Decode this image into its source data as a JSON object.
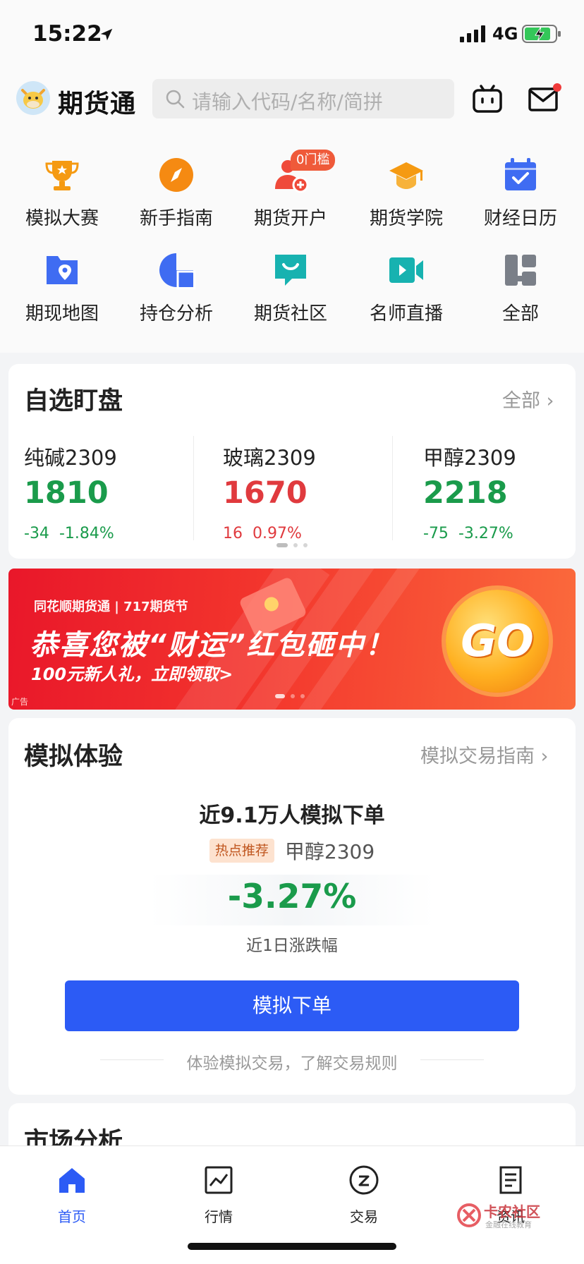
{
  "status_bar": {
    "time": "15:22",
    "network": "4G"
  },
  "header": {
    "app_name": "期货通",
    "search_placeholder": "请输入代码/名称/简拼"
  },
  "shortcuts": [
    {
      "label": "模拟大赛",
      "icon": "trophy-icon"
    },
    {
      "label": "新手指南",
      "icon": "compass-icon"
    },
    {
      "label": "期货开户",
      "icon": "user-add-icon",
      "badge": "0门槛"
    },
    {
      "label": "期货学院",
      "icon": "graduation-cap-icon"
    },
    {
      "label": "财经日历",
      "icon": "calendar-icon"
    },
    {
      "label": "期现地图",
      "icon": "map-pin-icon"
    },
    {
      "label": "持仓分析",
      "icon": "pie-chart-icon"
    },
    {
      "label": "期货社区",
      "icon": "chat-bubble-icon"
    },
    {
      "label": "名师直播",
      "icon": "video-camera-icon"
    },
    {
      "label": "全部",
      "icon": "grid-all-icon"
    }
  ],
  "watchlist": {
    "title": "自选盯盘",
    "more": "全部",
    "items": [
      {
        "name": "纯碱2309",
        "price": "1810",
        "change": "-34",
        "pct": "-1.84%",
        "color": "#1a9b4b"
      },
      {
        "name": "玻璃2309",
        "price": "1670",
        "change": "16",
        "pct": "0.97%",
        "color": "#e03a3e"
      },
      {
        "name": "甲醇2309",
        "price": "2218",
        "change": "-75",
        "pct": "-3.27%",
        "color": "#1a9b4b"
      }
    ]
  },
  "banner": {
    "brand": "同花顺期货通 | 717期货节",
    "title": "恭喜您被“财运”红包砸中！",
    "subtitle": "100元新人礼，立即领取>",
    "go": "GO",
    "ad_label": "广告"
  },
  "simulation": {
    "title": "模拟体验",
    "guide_link": "模拟交易指南",
    "headline": "近9.1万人模拟下单",
    "hot_tag": "热点推荐",
    "contract": "甲醇2309",
    "pct": "-3.27%",
    "pct_label": "近1日涨跌幅",
    "button": "模拟下单",
    "note": "体验模拟交易，了解交易规则"
  },
  "market": {
    "title": "市场分析"
  },
  "tabbar": [
    {
      "label": "首页",
      "icon": "home-icon",
      "active": true
    },
    {
      "label": "行情",
      "icon": "chart-icon",
      "active": false
    },
    {
      "label": "交易",
      "icon": "trade-icon",
      "active": false
    },
    {
      "label": "资讯",
      "icon": "news-icon",
      "active": false
    }
  ],
  "watermark": {
    "title": "卡农社区",
    "subtitle": "金融在线教育"
  },
  "colors": {
    "accent": "#2c5bf5",
    "up": "#e03a3e",
    "down": "#1a9b4b"
  }
}
